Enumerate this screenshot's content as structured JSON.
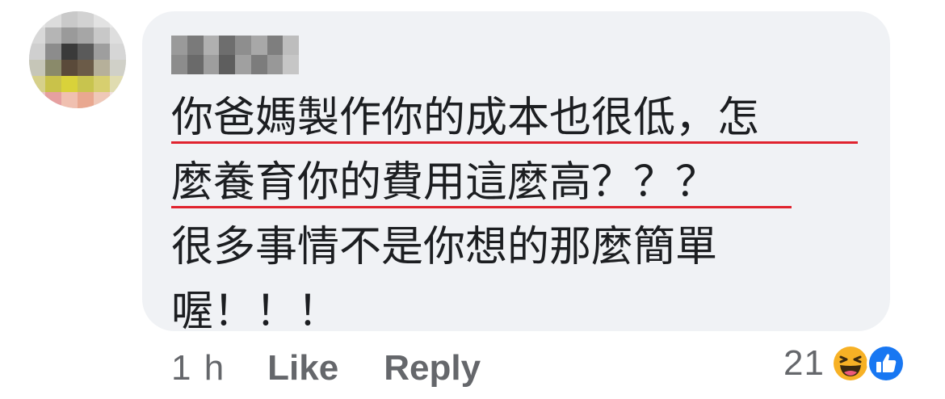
{
  "comment": {
    "author_name": "",
    "lines": [
      "你爸媽製作你的成本也很低，怎",
      "麼養育你的費用這麼高？？？",
      "很多事情不是你想的那麼簡單",
      "喔！！！"
    ]
  },
  "meta": {
    "time": "1 h",
    "like_label": "Like",
    "reply_label": "Reply"
  },
  "reactions": {
    "count": "21",
    "types": [
      "haha-icon",
      "like-icon"
    ],
    "colors": {
      "haha": "#f7b125",
      "like": "#1877f2"
    }
  },
  "colors": {
    "bubble": "#f0f2f5",
    "text": "#1c1e21",
    "meta": "#65676b",
    "annotation_underline": "#e0232e"
  }
}
